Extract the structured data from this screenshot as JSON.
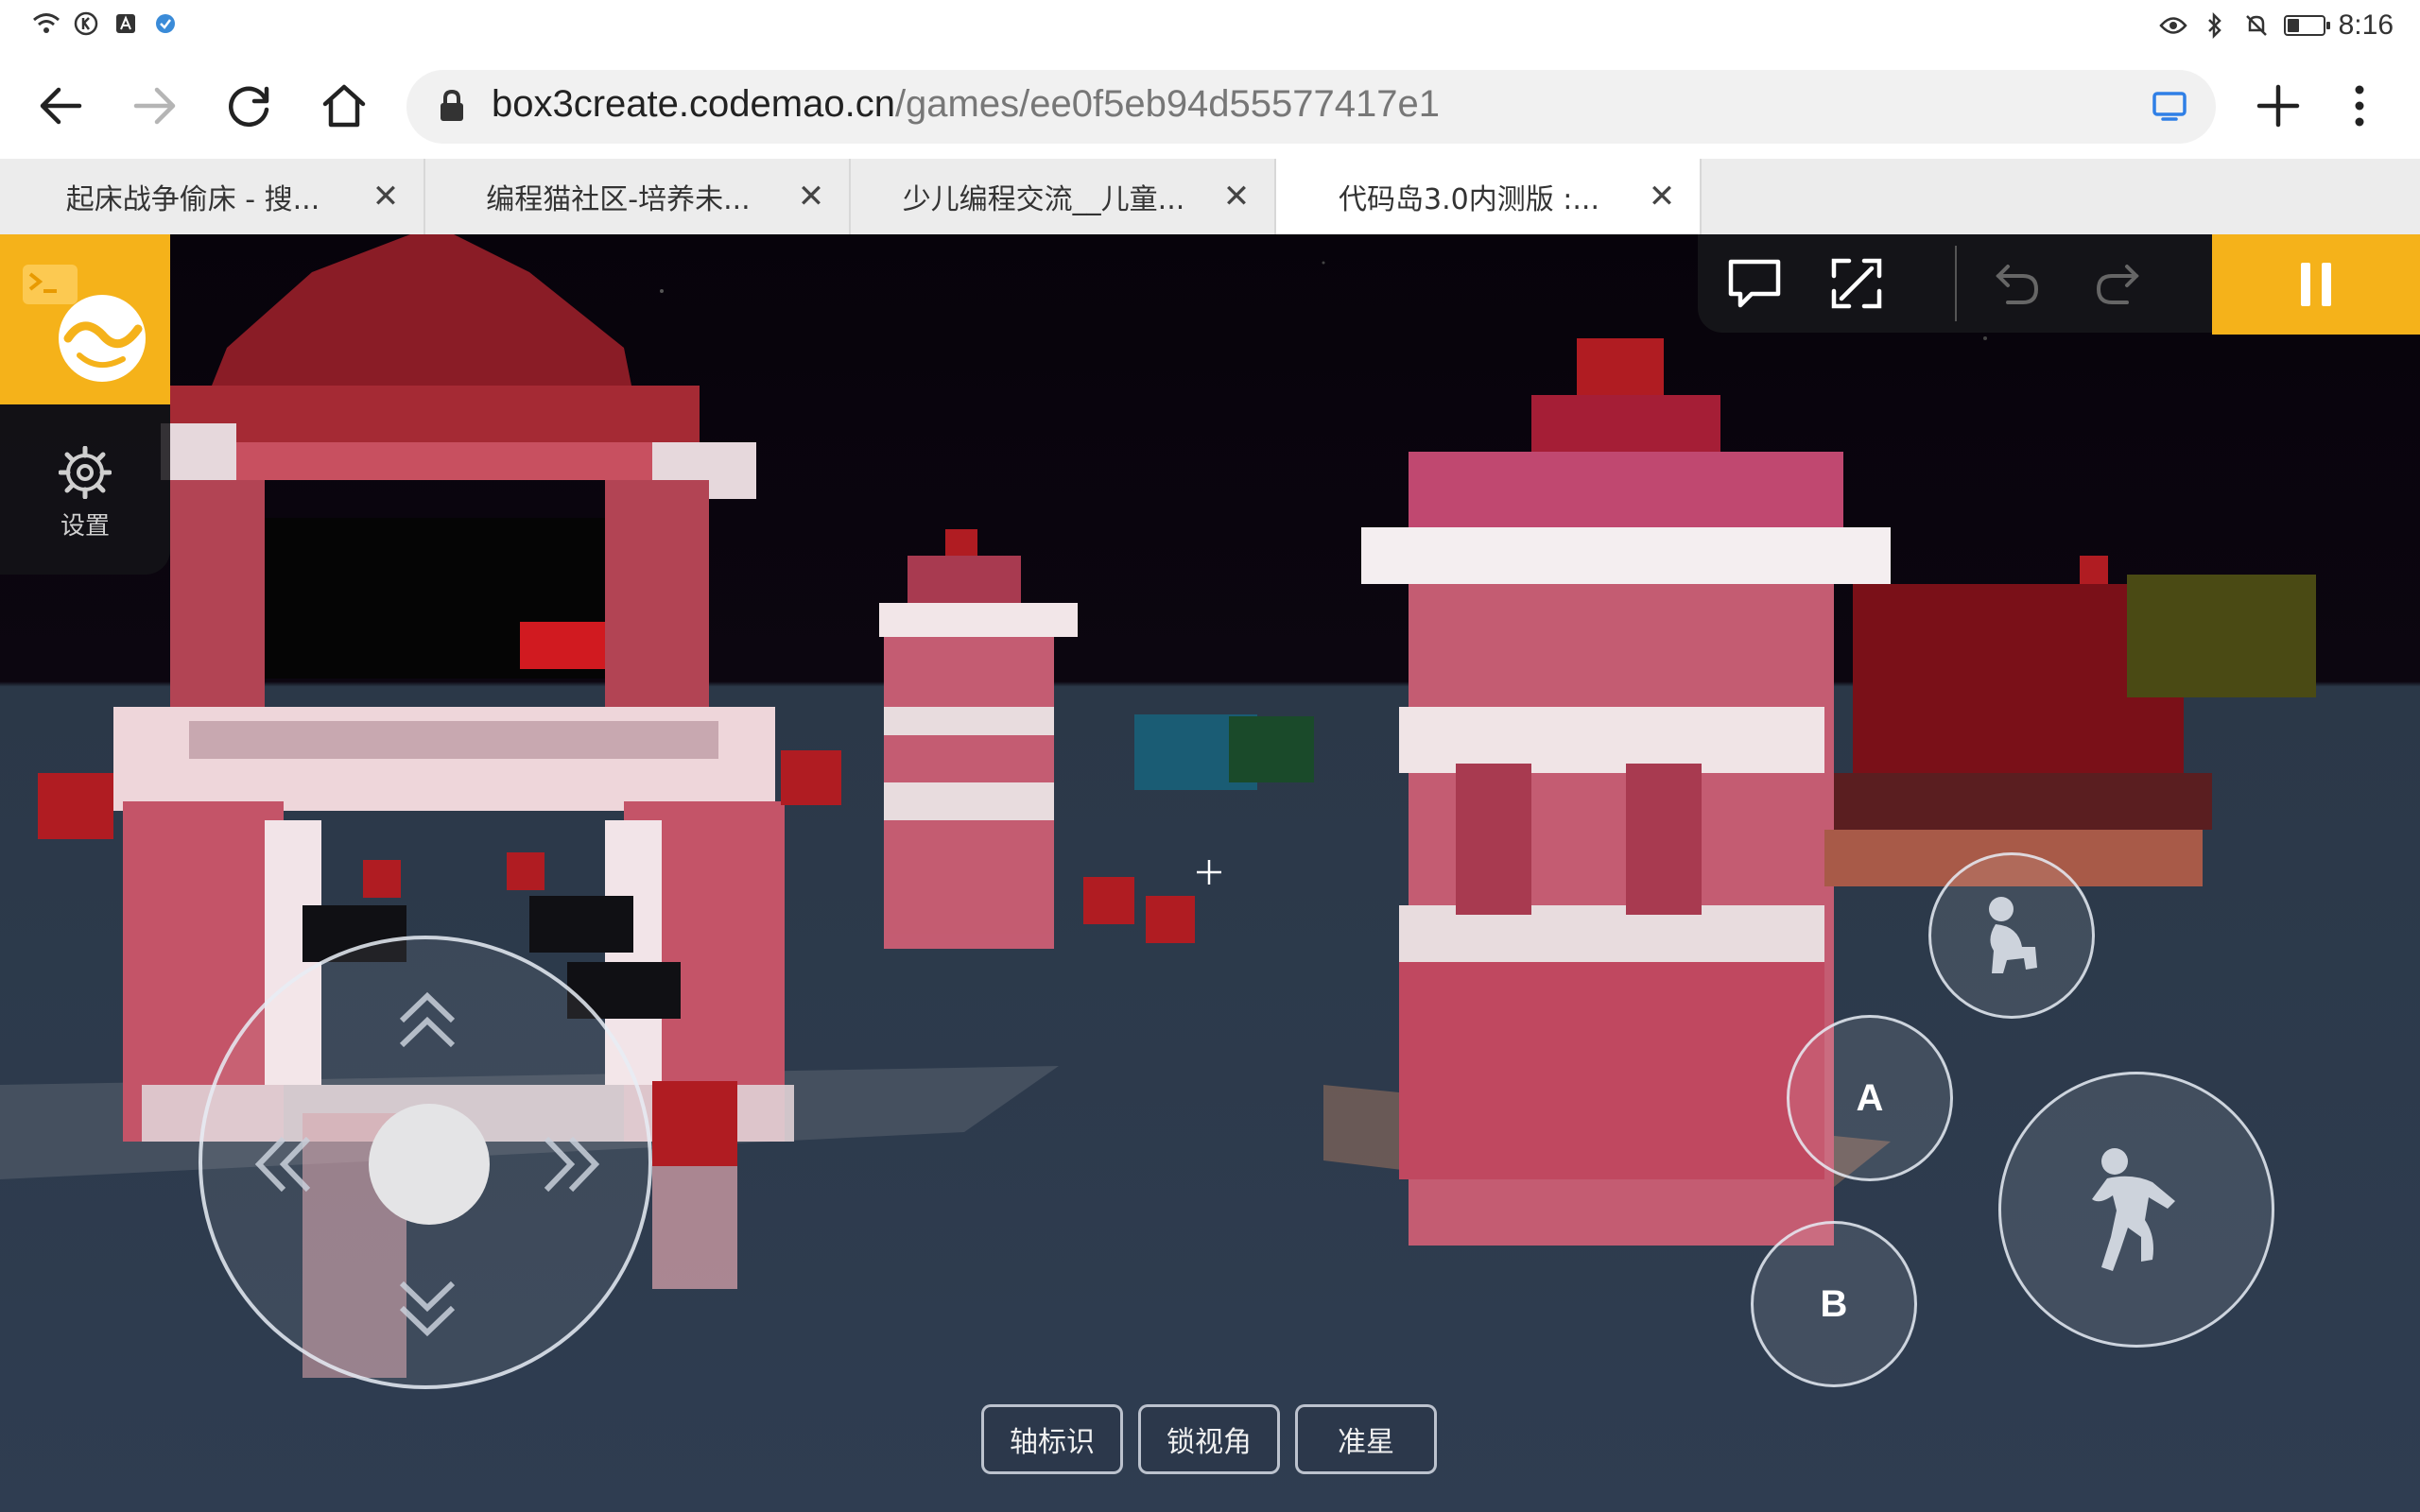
{
  "status_bar": {
    "time": "8:16",
    "battery_level": 0.35,
    "left_icons": [
      "wifi-icon",
      "k-app-icon",
      "a-app-icon",
      "shield-app-icon"
    ],
    "right_icons": [
      "eye-icon",
      "bluetooth-icon",
      "mute-icon",
      "battery-icon"
    ]
  },
  "browser": {
    "url_host": "box3create.codemao.cn",
    "url_path": "/games/ee0f5eb94d55577417e1",
    "tabs": [
      {
        "title": "起床战争偷床 - 搜...",
        "active": false
      },
      {
        "title": "编程猫社区-培养未...",
        "active": false
      },
      {
        "title": "少儿编程交流__儿童...",
        "active": false
      },
      {
        "title": "代码岛3.0内测版 :...",
        "active": true
      }
    ],
    "tab_close_glyph": "✕"
  },
  "game": {
    "settings_label": "设置",
    "action_a": "A",
    "action_b": "B",
    "bottom_buttons": [
      "轴标识",
      "锁视角",
      "准星"
    ],
    "colors": {
      "accent": "#f5b21a",
      "sky": "#0c0610",
      "ground": "#2f3d51"
    }
  }
}
